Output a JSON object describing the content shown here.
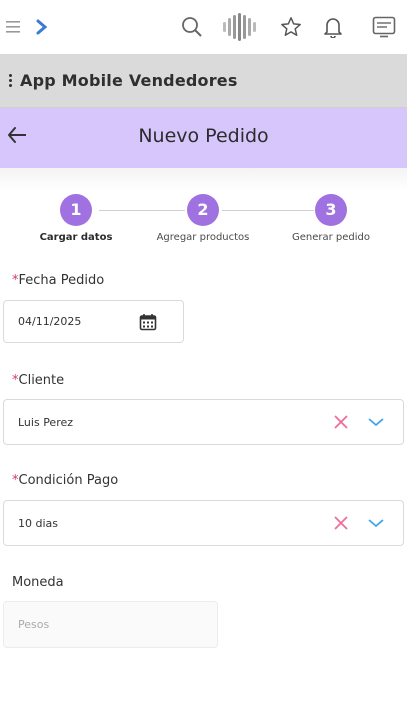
{
  "topbar": {
    "icons": [
      "menu-icon",
      "chevron-right-icon",
      "search-icon",
      "logo-icon",
      "star-icon",
      "bell-icon",
      "panel-icon"
    ]
  },
  "app": {
    "title": "App Mobile Vendedores"
  },
  "header": {
    "title": "Nuevo Pedido"
  },
  "stepper": {
    "steps": [
      {
        "number": "1",
        "label": "Cargar datos"
      },
      {
        "number": "2",
        "label": "Agregar productos"
      },
      {
        "number": "3",
        "label": "Generar pedido"
      }
    ]
  },
  "form": {
    "fecha": {
      "required": "*",
      "label": "Fecha Pedido",
      "value": "04/11/2025"
    },
    "cliente": {
      "required": "*",
      "label": "Cliente",
      "value": "Luis Perez"
    },
    "condicion": {
      "required": "*",
      "label": "Condición Pago",
      "value": "10 dias"
    },
    "moneda": {
      "label": "Moneda",
      "value": "Pesos"
    }
  },
  "colors": {
    "accent": "#a071e0",
    "header_bg": "#d6c6fb",
    "clear_icon": "#ef6b9a",
    "dropdown_icon": "#3fa6e8"
  }
}
